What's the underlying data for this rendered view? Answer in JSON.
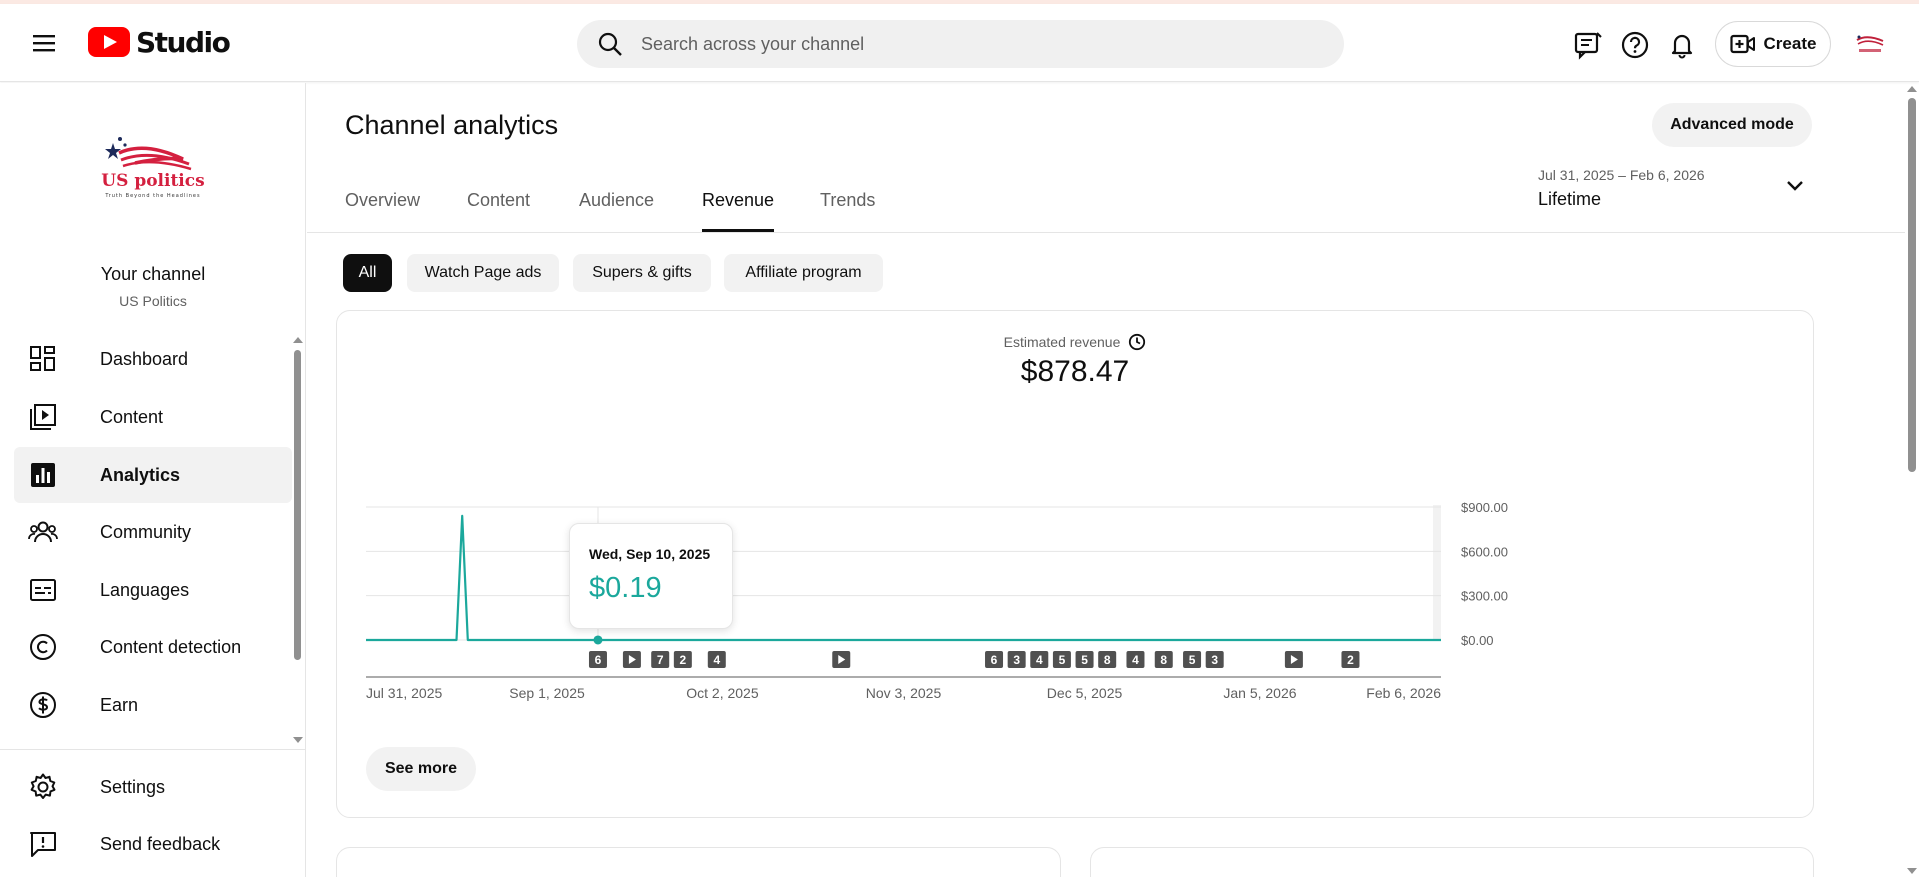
{
  "app": {
    "logo_text": "Studio"
  },
  "search": {
    "placeholder": "Search across your channel"
  },
  "header": {
    "create_label": "Create"
  },
  "sidebar": {
    "your_channel": "Your channel",
    "channel_name": "US Politics",
    "logo_text": "US politics",
    "logo_tagline": "Truth Beyond the Headlines",
    "items": [
      {
        "label": "Dashboard",
        "icon": "dashboard-icon"
      },
      {
        "label": "Content",
        "icon": "content-icon"
      },
      {
        "label": "Analytics",
        "icon": "analytics-icon",
        "active": true
      },
      {
        "label": "Community",
        "icon": "community-icon"
      },
      {
        "label": "Languages",
        "icon": "languages-icon"
      },
      {
        "label": "Content detection",
        "icon": "copyright-icon"
      },
      {
        "label": "Earn",
        "icon": "earn-icon"
      }
    ],
    "bottom_items": [
      {
        "label": "Settings",
        "icon": "settings-icon"
      },
      {
        "label": "Send feedback",
        "icon": "feedback-icon"
      }
    ]
  },
  "main": {
    "title": "Channel analytics",
    "advanced_mode": "Advanced mode",
    "tabs": [
      "Overview",
      "Content",
      "Audience",
      "Revenue",
      "Trends"
    ],
    "active_tab": "Revenue",
    "date_range": {
      "sub": "Jul 31, 2025 – Feb 6, 2026",
      "main": "Lifetime"
    },
    "chips": [
      "All",
      "Watch Page ads",
      "Supers & gifts",
      "Affiliate program"
    ],
    "active_chip": "All",
    "metric": {
      "label": "Estimated revenue",
      "value": "$878.47"
    },
    "tooltip": {
      "date": "Wed, Sep 10, 2025",
      "value": "$0.19"
    },
    "see_more": "See more"
  },
  "colors": {
    "accent": "#1ba89c",
    "brand_red": "#ff0000",
    "active_chip": "#0f0f0f"
  },
  "chart_data": {
    "type": "line",
    "series": [
      {
        "x": [
          "2025-07-31",
          "2025-08-16",
          "2025-08-17",
          "2025-08-18",
          "2025-08-19",
          "2025-09-10",
          "2026-02-06"
        ],
        "values": [
          0,
          0,
          840,
          0,
          0,
          0.19,
          0
        ]
      }
    ],
    "x_ticks": [
      "Jul 31, 2025",
      "Sep 1, 2025",
      "Oct 2, 2025",
      "Nov 3, 2025",
      "Dec 5, 2025",
      "Jan 5, 2026",
      "Feb 6, 2026"
    ],
    "y_ticks": [
      "$0.00",
      "$300.00",
      "$600.00",
      "$900.00"
    ],
    "ylim": [
      0,
      900
    ],
    "markers": [
      {
        "date": "2025-09-10",
        "label": "6"
      },
      {
        "date": "2025-09-16",
        "label": "play"
      },
      {
        "date": "2025-09-21",
        "label": "7"
      },
      {
        "date": "2025-09-25",
        "label": "2"
      },
      {
        "date": "2025-10-01",
        "label": "4"
      },
      {
        "date": "2025-10-23",
        "label": "play"
      },
      {
        "date": "2025-11-19",
        "label": "6"
      },
      {
        "date": "2025-11-23",
        "label": "3"
      },
      {
        "date": "2025-11-27",
        "label": "4"
      },
      {
        "date": "2025-12-01",
        "label": "5"
      },
      {
        "date": "2025-12-05",
        "label": "5"
      },
      {
        "date": "2025-12-09",
        "label": "8"
      },
      {
        "date": "2025-12-14",
        "label": "4"
      },
      {
        "date": "2025-12-19",
        "label": "8"
      },
      {
        "date": "2025-12-24",
        "label": "5"
      },
      {
        "date": "2025-12-28",
        "label": "3"
      },
      {
        "date": "2026-01-11",
        "label": "play"
      },
      {
        "date": "2026-01-21",
        "label": "2"
      }
    ],
    "highlight": {
      "date": "2025-09-10",
      "value": 0.19
    }
  }
}
